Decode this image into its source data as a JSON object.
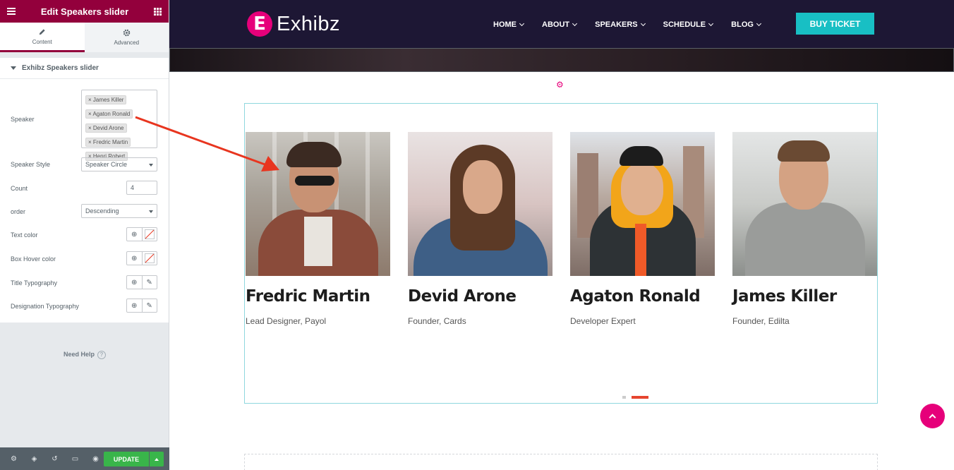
{
  "editor": {
    "title": "Edit Speakers slider",
    "tabs": [
      {
        "label": "Content",
        "icon": "pencil-icon"
      },
      {
        "label": "Advanced",
        "icon": "gear-icon"
      }
    ],
    "section_title": "Exhibz Speakers slider",
    "controls": {
      "speaker_label": "Speaker",
      "speaker_tags": [
        "James Killer",
        "Agaton Ronald",
        "Devid Arone",
        "Fredric Martin",
        "Henri Robert"
      ],
      "speaker_style_label": "Speaker Style",
      "speaker_style_value": "Speaker Circle",
      "count_label": "Count",
      "count_value": "4",
      "order_label": "order",
      "order_value": "Descending",
      "text_color_label": "Text color",
      "box_hover_color_label": "Box Hover color",
      "title_typography_label": "Title Typography",
      "designation_typography_label": "Designation Typography"
    },
    "need_help": "Need Help",
    "update_label": "UPDATE"
  },
  "site": {
    "logo_text": "Exhibz",
    "logo_mark": "E",
    "nav": [
      "HOME",
      "ABOUT",
      "SPEAKERS",
      "SCHEDULE",
      "BLOG"
    ],
    "buy_ticket": "BUY TICKET"
  },
  "speakers": [
    {
      "name": "Fredric Martin",
      "role": "Lead Designer, Payol"
    },
    {
      "name": "Devid Arone",
      "role": "Founder, Cards"
    },
    {
      "name": "Agaton Ronald",
      "role": "Developer Expert"
    },
    {
      "name": "James Killer",
      "role": "Founder, Edilta"
    }
  ],
  "slider": {
    "pages": 2,
    "active_page": 2
  },
  "colors": {
    "editor_accent": "#93003c",
    "brand_pink": "#e6007a",
    "buy_button": "#18bfc4",
    "update_green": "#39b54a",
    "annotation_arrow": "#e8351f"
  }
}
